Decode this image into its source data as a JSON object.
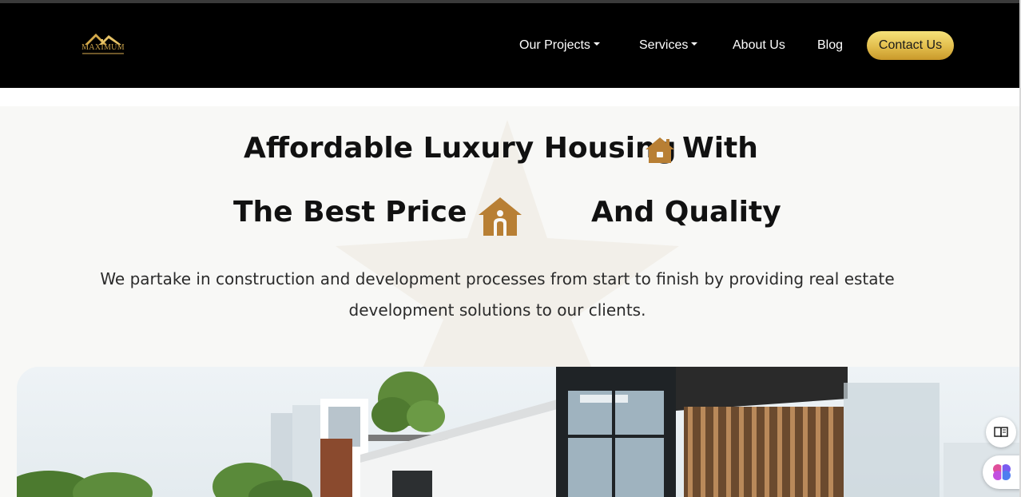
{
  "brand": {
    "logo_text": "MAXIMUM",
    "logo_icon": "house-roof-logo"
  },
  "nav": {
    "items": [
      {
        "label": "Our Projects",
        "has_dropdown": true
      },
      {
        "label": "Services",
        "has_dropdown": true
      },
      {
        "label": "About Us",
        "has_dropdown": false
      },
      {
        "label": "Blog",
        "has_dropdown": false
      }
    ],
    "contact_label": "Contact Us"
  },
  "hero": {
    "line1_part1": "Affordable Luxury Housing",
    "line1_part2": "With",
    "line2_part1": "The Best Price",
    "line2_part2": "And Quality",
    "description": "We partake in construction and development processes from start to finish by providing real estate development solutions to our clients.",
    "icons": [
      "house-icon",
      "house-person-icon"
    ],
    "image_alt": "modern-house-photo"
  },
  "side_tools": [
    {
      "icon": "book-icon"
    },
    {
      "icon": "brain-icon"
    }
  ],
  "colors": {
    "navbar_bg": "#000000",
    "accent_gold": "#e2bd4c",
    "icon_brown": "#b87f34",
    "hero_bg": "#f8f8f6"
  }
}
